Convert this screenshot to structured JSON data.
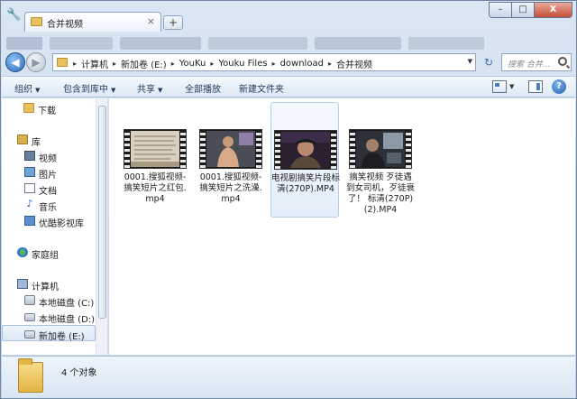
{
  "window": {
    "tab_title": "合并视频",
    "tab_close": "×",
    "new_tab": "+",
    "min": "–",
    "max": "□",
    "close": "X"
  },
  "address": {
    "back": "◀",
    "forward": "▶",
    "crumbs": [
      "计算机",
      "新加卷 (E:)",
      "YouKu",
      "Youku Files",
      "download",
      "合并视频"
    ],
    "separator": "▸",
    "refresh": "↻",
    "search_placeholder": "搜索 合并..."
  },
  "toolbar": {
    "organize": "组织",
    "include_in_library": "包含到库中",
    "share": "共享",
    "play_all": "全部播放",
    "new_folder": "新建文件夹",
    "dropdown_glyph": "▼",
    "help": "?"
  },
  "nav": {
    "items": [
      {
        "label": "下载",
        "icon": "download-folder-icon"
      },
      {
        "label": "库",
        "icon": "library-icon"
      },
      {
        "label": "视频",
        "icon": "video-library-icon"
      },
      {
        "label": "图片",
        "icon": "pictures-library-icon"
      },
      {
        "label": "文档",
        "icon": "documents-library-icon"
      },
      {
        "label": "音乐",
        "icon": "music-library-icon"
      },
      {
        "label": "优酷影视库",
        "icon": "youku-library-icon"
      },
      {
        "label": "家庭组",
        "icon": "homegroup-icon"
      },
      {
        "label": "计算机",
        "icon": "computer-icon"
      },
      {
        "label": "本地磁盘 (C:)",
        "icon": "system-drive-icon"
      },
      {
        "label": "本地磁盘 (D:)",
        "icon": "drive-icon"
      },
      {
        "label": "新加卷 (E:)",
        "icon": "drive-icon"
      }
    ]
  },
  "files": [
    {
      "name": "0001.搜狐视频-搞笑短片之红包.mp4",
      "thumb": "document-scene"
    },
    {
      "name": "0001.搜狐视频-搞笑短片之洗澡.mp4",
      "thumb": "bath-scene"
    },
    {
      "name": "电视剧搞笑片段标清(270P).MP4",
      "thumb": "face-scene"
    },
    {
      "name": "搞笑视频 歹徒遇到女司机，歹徒衰了！ 标清(270P)(2).MP4",
      "thumb": "car-scene"
    }
  ],
  "status": {
    "item_count": "4 个对象"
  },
  "colors": {
    "accent": "#1e395b",
    "selection_bg": "#dbe7f5",
    "close_button": "#c4503a"
  }
}
